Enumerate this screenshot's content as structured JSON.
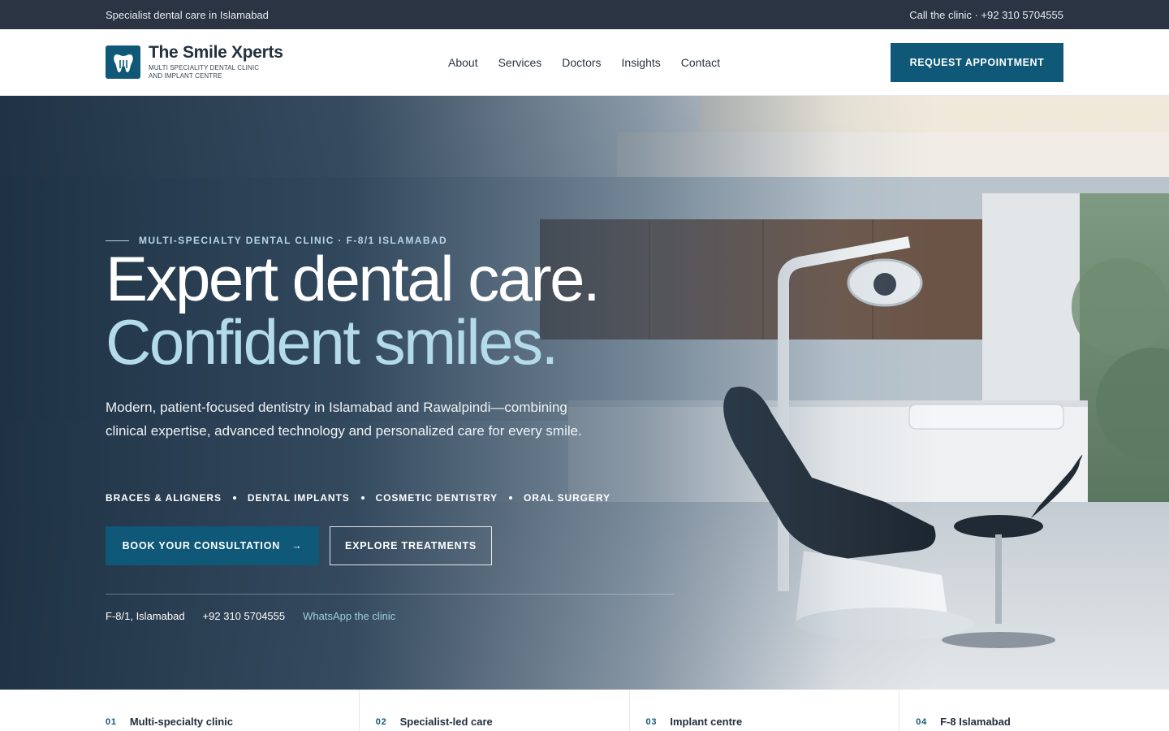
{
  "topbar": {
    "tagline": "Specialist dental care in Islamabad",
    "call": "Call the clinic · +92 310 5704555"
  },
  "brand": {
    "name": "The Smile Xperts",
    "sub_line1": "MULTI SPECIALITY DENTAL CLINIC",
    "sub_line2": "AND IMPLANT CENTRE",
    "color": "#0f5878"
  },
  "nav": {
    "items": [
      {
        "label": "About"
      },
      {
        "label": "Services"
      },
      {
        "label": "Doctors"
      },
      {
        "label": "Insights"
      },
      {
        "label": "Contact"
      }
    ],
    "cta": "REQUEST APPOINTMENT"
  },
  "hero": {
    "eyebrow": "MULTI-SPECIALTY DENTAL CLINIC · F-8/1 ISLAMABAD",
    "headline_line1": "Expert dental care.",
    "headline_line2": "Confident smiles.",
    "lede": "Modern, patient-focused dentistry in Islamabad and Rawalpindi—combining clinical expertise, advanced technology and personalized care for every smile.",
    "tags": [
      "BRACES & ALIGNERS",
      "DENTAL IMPLANTS",
      "COSMETIC DENTISTRY",
      "ORAL SURGERY"
    ],
    "primary_button": "BOOK YOUR CONSULTATION",
    "primary_button_arrow": "→",
    "secondary_button": "EXPLORE TREATMENTS",
    "address": "F-8/1, Islamabad",
    "phone": "+92 310 5704555",
    "whatsapp": "WhatsApp the clinic"
  },
  "features": [
    {
      "num": "01",
      "label": "Multi-specialty clinic"
    },
    {
      "num": "02",
      "label": "Specialist-led care"
    },
    {
      "num": "03",
      "label": "Implant centre"
    },
    {
      "num": "04",
      "label": "F-8 Islamabad"
    }
  ],
  "colors": {
    "topbar_bg": "#2b3443",
    "accent": "#0f5878",
    "headline_accent": "#b3dbea",
    "hero_dark": "#1c2f42"
  }
}
